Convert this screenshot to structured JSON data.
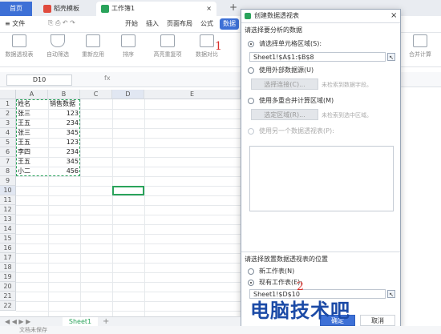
{
  "tabs": [
    {
      "label": "首页",
      "color": "#3d70d6"
    },
    {
      "label": "稻壳模板",
      "color": "#e04b3d"
    },
    {
      "label": "工作簿1",
      "color": "#2aa35b"
    }
  ],
  "tab_add": "+",
  "menu": {
    "items": [
      "≡ 文件",
      "开始",
      "插入",
      "页面布局",
      "公式",
      "数据"
    ],
    "active": "数据"
  },
  "ribbon": {
    "buttons": [
      "数据透视表",
      "自动筛选",
      "重新应用",
      "排序",
      "高亮重复项",
      "数据对比",
      "拒绝录入",
      "合并计算"
    ],
    "filter_labels": [
      "全部显示",
      "重新应用"
    ]
  },
  "formula_bar": {
    "name_box": "D10",
    "fx": "fx"
  },
  "grid": {
    "columns": [
      "A",
      "B",
      "C",
      "D",
      "E"
    ],
    "rows": [
      "1",
      "2",
      "3",
      "4",
      "5",
      "6",
      "7",
      "8",
      "9",
      "10",
      "11",
      "12",
      "13",
      "14",
      "15",
      "16",
      "17",
      "18",
      "19",
      "20",
      "21",
      "22"
    ],
    "data": [
      [
        "姓名",
        "销售数据"
      ],
      [
        "张三",
        "123"
      ],
      [
        "王五",
        "234"
      ],
      [
        "张三",
        "345"
      ],
      [
        "王五",
        "123"
      ],
      [
        "李四",
        "234"
      ],
      [
        "王五",
        "345"
      ],
      [
        "小二",
        "456"
      ]
    ],
    "selected_cell": "D10"
  },
  "dialog": {
    "title": "创建数据透视表",
    "section1": "请选择要分析的数据",
    "opt_range": "请选择单元格区域(S):",
    "range_value": "Sheet1!$A$1:$B$8",
    "opt_external": "使用外部数据源(U)",
    "btn_choose_conn": "选择连接(C)...",
    "hint_conn": "未检索到数据字段。",
    "opt_multi": "使用多重合并计算区域(M)",
    "btn_choose_area": "选定区域(R)...",
    "hint_area": "未检索到选中区域。",
    "opt_another": "使用另一个数据透视表(P):",
    "section2": "请选择放置数据透视表的位置",
    "opt_new": "新工作表(N)",
    "opt_existing": "现有工作表(E):",
    "existing_value": "Sheet1!$D$10",
    "ok": "确定",
    "cancel": "取消",
    "close": "×"
  },
  "annotations": {
    "one": "1",
    "two": "2"
  },
  "sheet_tab": "Sheet1",
  "status": "文档未保存",
  "watermark": "电脑技术吧"
}
